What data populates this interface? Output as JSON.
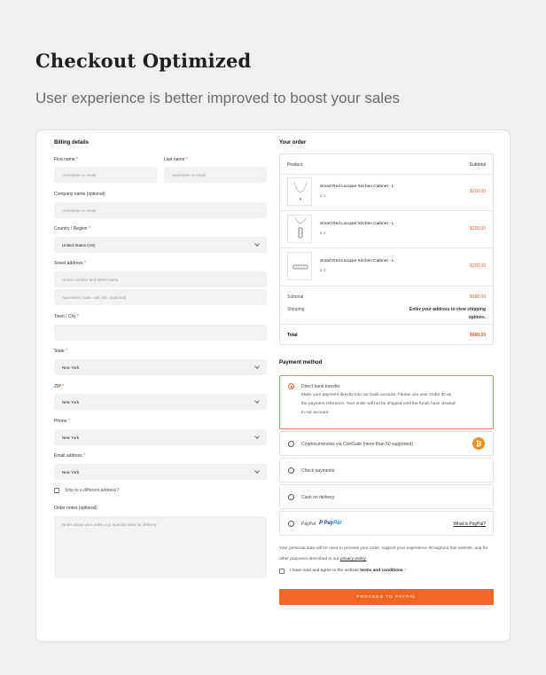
{
  "hero": {
    "title": "Checkout Optimized",
    "subtitle": "User experience is better improved to boost your sales"
  },
  "billing": {
    "title": "Billing details",
    "first_name": {
      "label": "First name",
      "required": "*",
      "placeholder": "Username or email"
    },
    "last_name": {
      "label": "Last name",
      "required": "*",
      "placeholder": "Username or email"
    },
    "company": {
      "label": "Company name (optional)",
      "placeholder": "Username or email"
    },
    "country": {
      "label": "Country / Region",
      "required": "*",
      "value": "United States (US)"
    },
    "street": {
      "label": "Street address",
      "required": "*",
      "placeholder": "House number and street name",
      "placeholder2": "Apartment, suite, unit, etc. (optional)"
    },
    "town": {
      "label": "Town / City",
      "required": "*",
      "value": ""
    },
    "state": {
      "label": "State",
      "required": "*",
      "value": "New York"
    },
    "zip": {
      "label": "ZIP",
      "required": "*",
      "value": "New York"
    },
    "phone": {
      "label": "Phone",
      "required": "*",
      "value": "New York"
    },
    "email": {
      "label": "Email address",
      "required": "*",
      "value": "New York"
    },
    "ship_different": "Ship to a different address?",
    "notes": {
      "label": "Order notes (optional)",
      "placeholder": "Notes about your order, e.g. special notes for delivery."
    }
  },
  "order": {
    "title": "Your order",
    "col_product": "Product",
    "col_subtotal": "Subtotal",
    "items": [
      {
        "name": "Smart Red Lacquer Kitchen Cabinet - L",
        "qty": "x 1",
        "price": "$220.00"
      },
      {
        "name": "Smart Red Lacquer Kitchen Cabinet - L",
        "qty": "x 1",
        "price": "$220.00"
      },
      {
        "name": "Smart Red Lacquer Kitchen Cabinet - L",
        "qty": "x 1",
        "price": "$220.00"
      }
    ],
    "subtotal_label": "Subtotal",
    "subtotal_value": "$680.00",
    "shipping_label": "Shipping",
    "shipping_line1": "Enter your address to view shipping",
    "shipping_line2": "options.",
    "total_label": "Total",
    "total_value": "$680.00"
  },
  "payment": {
    "title": "Payment method",
    "bank": {
      "label": "Direct bank transfer",
      "desc1": "Make your payment directly into our bank account. Please use your Order ID as",
      "desc2": "the payment reference. Your order will not be shipped until the funds have cleared",
      "desc3": "in our account."
    },
    "crypto": {
      "label": "Cryptocurrencies via CoinGate (more than 50 supported)",
      "icon": "bitcoin-icon"
    },
    "check": {
      "label": "Check payments"
    },
    "cod": {
      "label": "Cash on delivery"
    },
    "paypal": {
      "label": "PayPal",
      "logo_a": "Pay",
      "logo_b": "Pal",
      "link": "What is PayPal?"
    }
  },
  "privacy": {
    "text": "Your personal data will be used to process your order, support your experience throughout this website, and for other purposes described in our",
    "link": "privacy policy."
  },
  "terms": {
    "prefix": "I have read and agree to the website",
    "link": "terms and conditions",
    "required": "*"
  },
  "proceed_label": "PROCEED TO PAYPAL",
  "colors": {
    "accent": "#f26522",
    "price": "#e0612a",
    "bitcoin": "#f7931a"
  }
}
